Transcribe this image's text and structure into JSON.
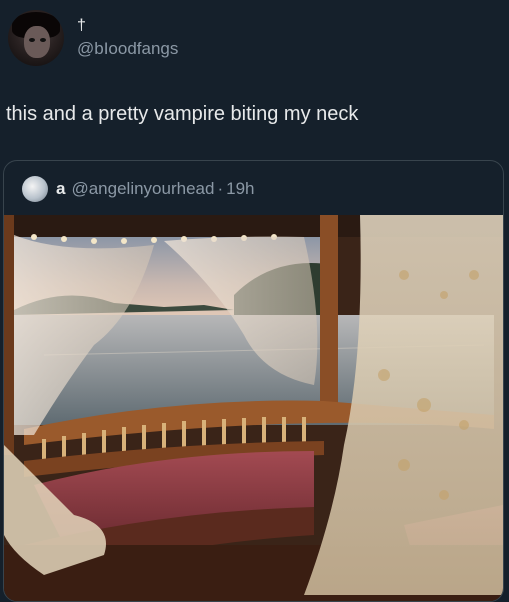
{
  "tweet": {
    "display_name": "†",
    "handle": "@bIoodfangs",
    "text": "this and a pretty vampire biting my neck"
  },
  "quoted_tweet": {
    "display_name": "a",
    "handle": "@angelinyourhead",
    "separator": "·",
    "time": "19h"
  },
  "colors": {
    "background": "#15202b",
    "primary_text": "#e7e9ea",
    "secondary_text": "#8b98a5",
    "border": "#38444d"
  }
}
